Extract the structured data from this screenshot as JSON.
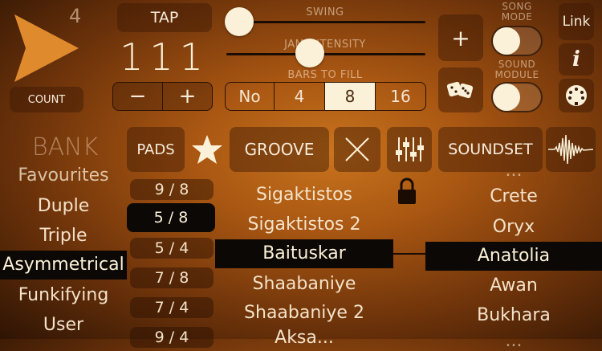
{
  "count_display": "4",
  "count_label": "COUNT",
  "tap_label": "TAP",
  "tempo": "111",
  "minus_label": "−",
  "plus_label": "+",
  "swing": {
    "label": "SWING",
    "value": 0.0
  },
  "jam": {
    "label": "JAM INTENSITY",
    "value": 0.4
  },
  "bars": {
    "label": "BARS TO FILL",
    "options": [
      "No",
      "4",
      "8",
      "16"
    ],
    "selected": "8"
  },
  "add_label": "+",
  "song_mode": {
    "label": "SONG\nMODE",
    "on": false
  },
  "sound_module": {
    "label": "SOUND\nMODULE",
    "on": false
  },
  "link_label": "Link",
  "info_label": "i",
  "bank_label": "BANK",
  "pads_label": "PADS",
  "groove_label": "GROOVE",
  "soundset_label": "SOUNDSET",
  "banks": [
    "Favourites",
    "Duple",
    "Triple",
    "Asymmetrical",
    "Funkifying",
    "User"
  ],
  "bank_selected": "Asymmetrical",
  "time_signatures": [
    "9 / 8",
    "5 / 8",
    "5 / 4",
    "7 / 8",
    "7 / 4",
    "9 / 4"
  ],
  "ts_selected": "5 / 8",
  "grooves": [
    "Sigaktistos",
    "Sigaktistos 2",
    "Baituskar",
    "Shaabaniye",
    "Shaabaniye 2",
    "Aksa..."
  ],
  "groove_selected": "Baituskar",
  "soundsets": [
    "...",
    "Crete",
    "Oryx",
    "Anatolia",
    "Awan",
    "Bukhara",
    "..."
  ],
  "soundset_selected": "Anatolia",
  "colors": {
    "accent": "#fbf1d8",
    "selected_bg": "#0c0805",
    "bg": "#a85612"
  }
}
